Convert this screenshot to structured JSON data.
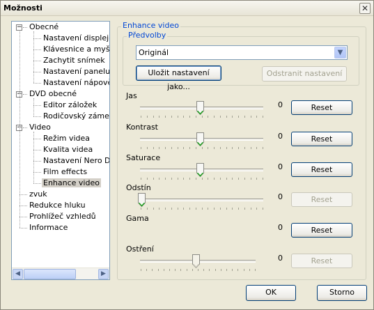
{
  "window": {
    "title": "Možnosti",
    "close_glyph": "✕"
  },
  "tree": {
    "items": [
      {
        "label": "Obecné",
        "expander": "−",
        "level": 0
      },
      {
        "label": "Nastavení displeje",
        "level": 1
      },
      {
        "label": "Klávesnice a myš",
        "level": 1
      },
      {
        "label": "Zachytit snímek",
        "level": 1
      },
      {
        "label": "Nastavení panelu ná",
        "level": 1
      },
      {
        "label": "Nastavení nápovědy",
        "level": 1
      },
      {
        "label": "DVD obecné",
        "expander": "−",
        "level": 0
      },
      {
        "label": "Editor záložek",
        "level": 1
      },
      {
        "label": "Rodičovský zámek",
        "level": 1
      },
      {
        "label": "Video",
        "expander": "−",
        "level": 0
      },
      {
        "label": "Režim videa",
        "level": 1
      },
      {
        "label": "Kvalita videa",
        "level": 1
      },
      {
        "label": "Nastavení Nero Digit",
        "level": 1
      },
      {
        "label": "Film effects",
        "level": 1
      },
      {
        "label": "Enhance video",
        "level": 1,
        "selected": true
      },
      {
        "label": "zvuk",
        "level": 0
      },
      {
        "label": "Redukce hluku",
        "level": 0
      },
      {
        "label": "Prohlížeč vzhledů",
        "level": 0
      },
      {
        "label": "Informace",
        "level": 0
      }
    ],
    "scroll_left_glyph": "◀",
    "scroll_right_glyph": "▶"
  },
  "panel": {
    "title": "Enhance video",
    "presets": {
      "legend": "Předvolby",
      "selected": "Originál",
      "dropdown_glyph": "▼",
      "save_label": "Uložit nastavení jako...",
      "remove_label": "Odstranit nastavení"
    },
    "sliders": [
      {
        "label": "Jas",
        "value": "0",
        "reset": "Reset",
        "enabled": true,
        "level": 0.5
      },
      {
        "label": "Kontrast",
        "value": "0",
        "reset": "Reset",
        "enabled": true,
        "level": 0.5
      },
      {
        "label": "Saturace",
        "value": "0",
        "reset": "Reset",
        "enabled": true,
        "level": 0.5
      },
      {
        "label": "Odstín",
        "value": "0",
        "reset": "Reset",
        "enabled": false,
        "level": 0.0
      },
      {
        "label": "Gama",
        "value": "0",
        "reset": "Reset",
        "enabled": true,
        "level": null
      },
      {
        "label": "Ostření",
        "value": "0",
        "reset": "Reset",
        "enabled": false,
        "level": 0.5,
        "disabled_slider": true
      }
    ]
  },
  "footer": {
    "ok_label": "OK",
    "cancel_label": "Storno"
  },
  "colors": {
    "accent": "#0046d5",
    "button_border": "#003c74",
    "thumb_green": "#21a121"
  }
}
